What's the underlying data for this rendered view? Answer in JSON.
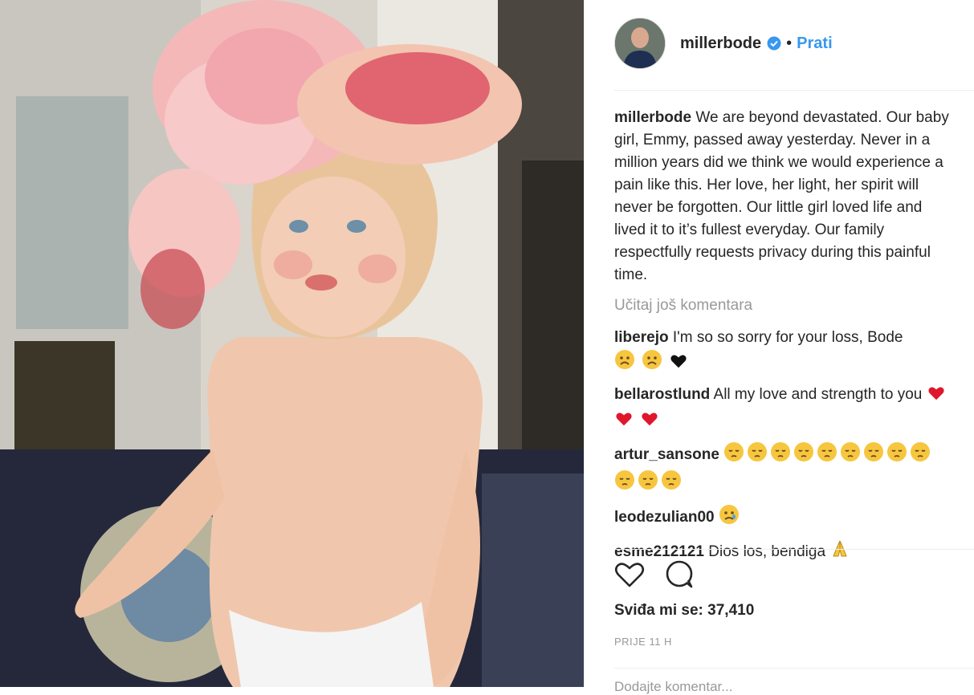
{
  "post": {
    "username": "millerbode",
    "dot": "•",
    "follow_label": "Prati",
    "caption": "We are beyond devastated. Our baby girl, Emmy, passed away yesterday. Never in a million years did we think we would experience a pain like this. Her love, her light, her spirit will never be forgotten. Our little girl loved life and lived it to it’s fullest everyday. Our family respectfully requests privacy during this painful time.",
    "load_more": "Učitaj još komentara",
    "likes": "Sviđa mi se: 37,410",
    "time": "PRIJE 11 H",
    "add_comment_placeholder": "Dodajte komentar..."
  },
  "comments": [
    {
      "user": "liberejo",
      "text": "I'm so so sorry for your loss, Bode",
      "emojis": [
        "sad-face",
        "sad-face",
        "black-heart"
      ]
    },
    {
      "user": "bellarostlund",
      "text": "All my love and strength to you",
      "emojis": [
        "red-heart",
        "red-heart",
        "red-heart"
      ]
    },
    {
      "user": "artur_sansone",
      "text": "",
      "emojis": [
        "pensive-face",
        "pensive-face",
        "pensive-face",
        "pensive-face",
        "pensive-face",
        "pensive-face",
        "pensive-face",
        "pensive-face",
        "pensive-face",
        "pensive-face",
        "pensive-face",
        "pensive-face"
      ]
    },
    {
      "user": "leodezulian00",
      "text": "",
      "emojis": [
        "crying-face"
      ]
    },
    {
      "user": "esme212121",
      "text": "Dios los, bendiga",
      "emojis": [
        "praying-hands"
      ]
    }
  ],
  "colors": {
    "link": "#3897f0",
    "muted": "#999999",
    "text": "#262626"
  }
}
